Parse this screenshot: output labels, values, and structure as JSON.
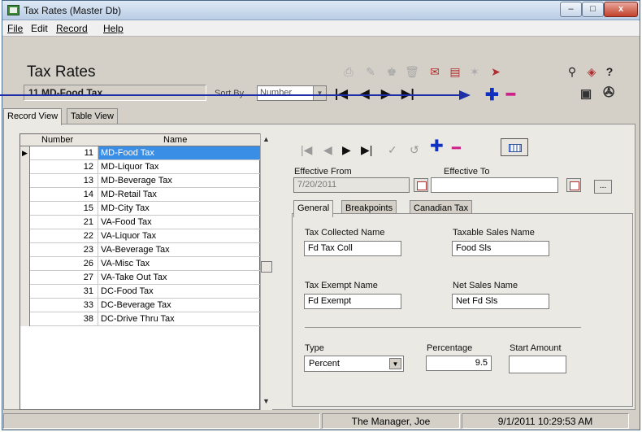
{
  "window": {
    "title": "Tax Rates (Master Db)",
    "min_glyph": "–",
    "max_glyph": "□",
    "close_glyph": "x"
  },
  "menu": [
    "File",
    "Edit",
    "Record",
    "Help"
  ],
  "header": {
    "title": "Tax Rates",
    "record_label": "11 MD-Food Tax",
    "sort_by_label": "Sort By",
    "sort_by_value": "Number"
  },
  "tabs_top": [
    "Record View",
    "Table View"
  ],
  "grid": {
    "columns": [
      "Number",
      "Name"
    ],
    "rows": [
      {
        "number": "11",
        "name": "MD-Food Tax",
        "selected": true
      },
      {
        "number": "12",
        "name": "MD-Liquor Tax"
      },
      {
        "number": "13",
        "name": "MD-Beverage Tax"
      },
      {
        "number": "14",
        "name": "MD-Retail Tax"
      },
      {
        "number": "15",
        "name": "MD-City Tax"
      },
      {
        "number": "21",
        "name": "VA-Food Tax"
      },
      {
        "number": "22",
        "name": "VA-Liquor Tax"
      },
      {
        "number": "23",
        "name": "VA-Beverage Tax"
      },
      {
        "number": "26",
        "name": "VA-Misc Tax"
      },
      {
        "number": "27",
        "name": "VA-Take Out Tax"
      },
      {
        "number": "31",
        "name": "DC-Food Tax"
      },
      {
        "number": "33",
        "name": "DC-Beverage Tax"
      },
      {
        "number": "38",
        "name": "DC-Drive Thru Tax"
      }
    ]
  },
  "effective": {
    "from_label": "Effective From",
    "from_value": "7/20/2011",
    "to_label": "Effective To",
    "to_value": "",
    "ellipsis": "..."
  },
  "tabs_detail": [
    "General",
    "Breakpoints",
    "Canadian Tax"
  ],
  "general": {
    "tax_collected_label": "Tax Collected Name",
    "tax_collected_value": "Fd Tax Coll",
    "taxable_sales_label": "Taxable Sales Name",
    "taxable_sales_value": "Food Sls",
    "tax_exempt_label": "Tax Exempt Name",
    "tax_exempt_value": "Fd Exempt",
    "net_sales_label": "Net Sales Name",
    "net_sales_value": "Net Fd Sls",
    "type_label": "Type",
    "type_value": "Percent",
    "percentage_label": "Percentage",
    "percentage_value": "9.5",
    "start_amount_label": "Start Amount",
    "start_amount_value": ""
  },
  "status": {
    "user": "The Manager, Joe",
    "datetime": "9/1/2011 10:29:53 AM"
  },
  "colors": {
    "accent": "#1e2ea8",
    "selection": "#3a8ee6",
    "add": "#1030c0",
    "delete": "#d0208a"
  }
}
